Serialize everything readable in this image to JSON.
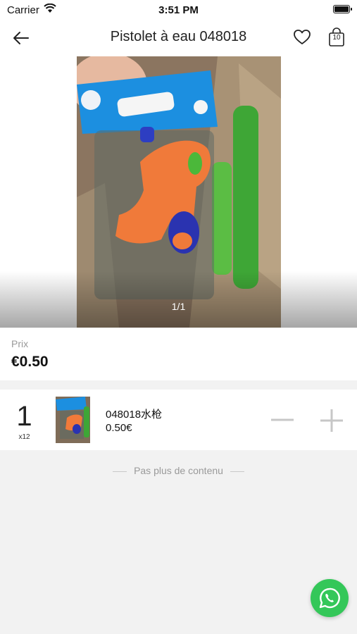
{
  "status_bar": {
    "carrier": "Carrier",
    "time": "3:51 PM"
  },
  "nav": {
    "title": "Pistolet à eau 048018",
    "cart_count": "10"
  },
  "gallery": {
    "pager": "1/1"
  },
  "price": {
    "label": "Prix",
    "value": "€0.50"
  },
  "variant": {
    "quantity": "1",
    "pack": "x12",
    "name": "048018水枪",
    "price": "0.50€"
  },
  "footer": {
    "end_text": "Pas plus de contenu"
  },
  "colors": {
    "whatsapp": "#34c759",
    "orange_toy": "#f07a3a",
    "blue_package": "#1c8fe0"
  },
  "icons": [
    "back-arrow-icon",
    "heart-icon",
    "cart-icon",
    "minus-icon",
    "plus-icon",
    "whatsapp-icon",
    "wifi-icon",
    "battery-icon"
  ]
}
